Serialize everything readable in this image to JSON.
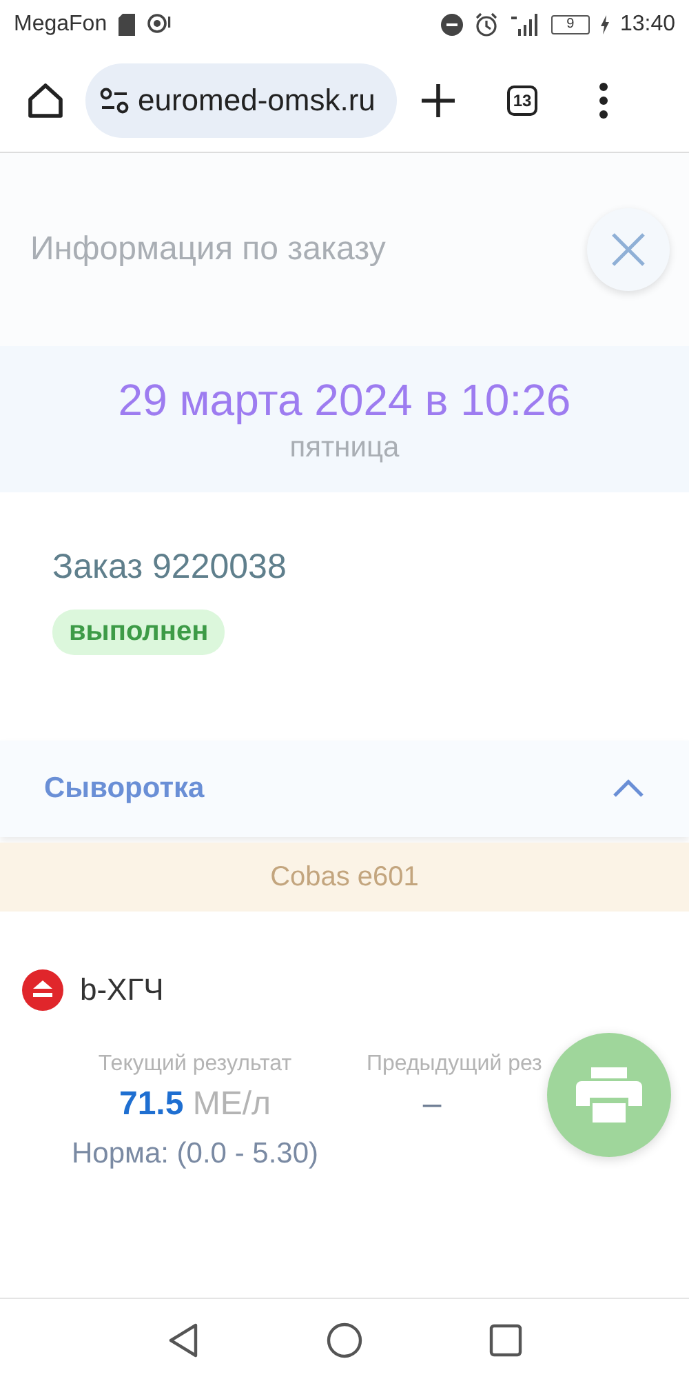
{
  "status_bar": {
    "carrier": "MegaFon",
    "battery": "9",
    "time": "13:40"
  },
  "browser": {
    "url": "euromed-omsk.ru",
    "tab_count": "13"
  },
  "header": {
    "title": "Информация по заказу"
  },
  "date": {
    "text": "29 марта 2024 в 10:26",
    "weekday": "пятница"
  },
  "order": {
    "title": "Заказ 9220038",
    "status": {
      "label": "выполнен",
      "kind": "done"
    }
  },
  "section": {
    "title": "Сыворотка",
    "expanded": true,
    "analyzer": "Cobas e601",
    "tests": [
      {
        "name": "b-ХГЧ",
        "color": "#e0262b",
        "current_label": "Текущий результат",
        "value": "71.5",
        "unit": "МЕ/л",
        "norm": "Норма: (0.0 - 5.30)",
        "previous_label": "Предыдущий рез",
        "previous_value": "–"
      }
    ]
  }
}
